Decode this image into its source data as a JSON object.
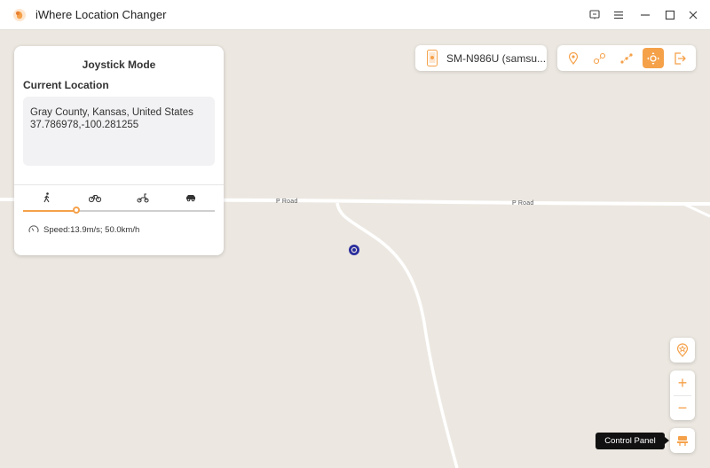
{
  "window": {
    "title": "iWhere Location Changer",
    "icons": [
      "feedback-icon",
      "menu-icon",
      "minimize-icon",
      "maximize-icon",
      "close-icon"
    ]
  },
  "map": {
    "roads": [
      {
        "label": "P Road"
      },
      {
        "label": "P Road"
      }
    ]
  },
  "panel": {
    "title": "Joystick Mode",
    "current_location_label": "Current Location",
    "address": "Gray County, Kansas, United States",
    "coordinates": "37.786978,-100.281255",
    "modes": [
      "walk-icon",
      "bike-icon",
      "moped-icon",
      "car-icon"
    ],
    "speed_fraction": 0.28,
    "speed_text": "Speed:13.9m/s; 50.0km/h"
  },
  "device": {
    "name": "SM-N986U (samsu..."
  },
  "toolbar": {
    "tools": [
      "teleport-icon",
      "one-stop-icon",
      "multi-stop-icon",
      "joystick-icon",
      "exit-icon"
    ],
    "active": "joystick-icon"
  },
  "controls": {
    "zoom_in": "+",
    "zoom_out": "−",
    "tooltip": "Control Panel"
  },
  "colors": {
    "accent": "#f5a14a",
    "map_bg": "#ece8e1",
    "marker": "#2a2d9c"
  }
}
